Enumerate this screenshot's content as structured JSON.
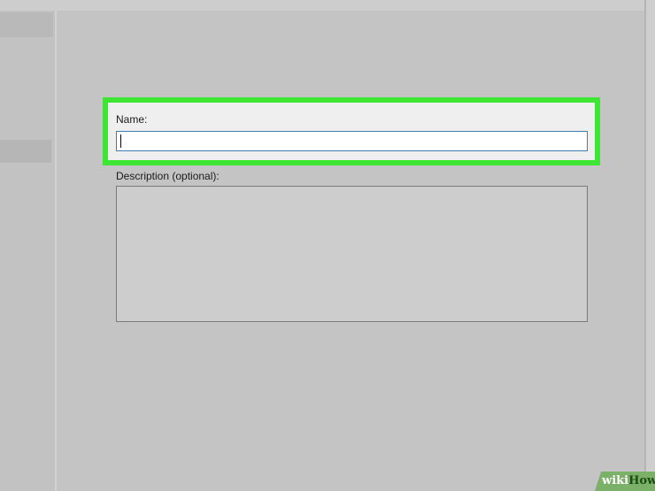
{
  "form": {
    "name_label": "Name:",
    "name_value": "",
    "description_label": "Description (optional):",
    "description_value": ""
  },
  "highlight": {
    "color": "#3de632",
    "target": "name-field-group"
  },
  "watermark": {
    "part1": "wiki",
    "part2": "How"
  },
  "colors": {
    "input_focus_border": "#3c7fb1",
    "background": "#c4c4c4"
  }
}
